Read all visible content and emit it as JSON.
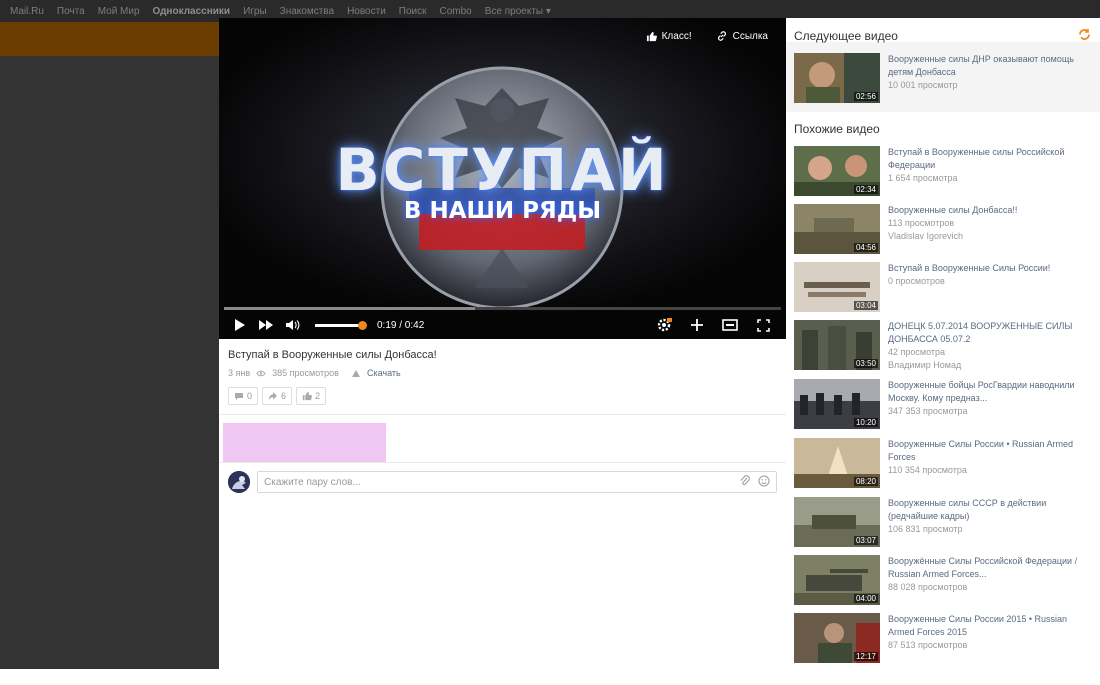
{
  "topbar": {
    "links": [
      "Mail.Ru",
      "Почта",
      "Мой Мир",
      "Одноклассники",
      "Игры",
      "Знакомства",
      "Новости",
      "Поиск",
      "Combo",
      "Все проекты ▾"
    ]
  },
  "player": {
    "headline": "ВСТУПАЙ",
    "subheadline": "В НАШИ РЯДЫ",
    "class_label": "Класс!",
    "link_label": "Ссылка",
    "time": "0:19 / 0:42",
    "progress_fraction": 0.45,
    "volume_fraction": 1.0
  },
  "video": {
    "title": "Вступай в Вооруженные силы Донбасса!",
    "date": "3 янв",
    "views": "385 просмотров",
    "download": "Скачать",
    "comments_count": "0",
    "shares_count": "6",
    "likes_count": "2"
  },
  "comment": {
    "placeholder": "Скажите пару слов..."
  },
  "sidebar": {
    "next_title": "Следующее видео",
    "similar_title": "Похожие видео",
    "next_video": {
      "title": "Вооруженные силы ДНР оказывают помощь детям Донбасса",
      "views": "10 001 просмотр",
      "duration": "02:56"
    },
    "similar": [
      {
        "title": "Вступай в Вооруженные силы Российской Федерации",
        "views": "1 654 просмотра",
        "author": "",
        "duration": "02:34"
      },
      {
        "title": "Вооруженные силы Донбасса!!",
        "views": "113 просмотров",
        "author": "Vladislav Igorevich",
        "duration": "04:56"
      },
      {
        "title": "Вступай в Вооруженные Силы России!",
        "views": "0 просмотров",
        "author": "",
        "duration": "03:04"
      },
      {
        "title": "ДОНЕЦК 5.07.2014 ВООРУЖЕННЫЕ СИЛЫ ДОНБАССА 05.07.2",
        "views": "42 просмотра",
        "author": "Владимир Номад",
        "duration": "03:50"
      },
      {
        "title": "Вооруженные бойцы РосГвардии наводнили Москву. Кому предназ...",
        "views": "347 353 просмотра",
        "author": "",
        "duration": "10:20"
      },
      {
        "title": "Вооруженные Силы России • Russian Armed Forces",
        "views": "110 354 просмотра",
        "author": "",
        "duration": "08:20"
      },
      {
        "title": "Вооруженные силы СССР в действии (редчайшие кадры)",
        "views": "106 831 просмотр",
        "author": "",
        "duration": "03:07"
      },
      {
        "title": "Вооружённые Силы Российской Федерации / Russian Armed Forces...",
        "views": "88 028 просмотров",
        "author": "",
        "duration": "04:00"
      },
      {
        "title": "Вооруженные Силы России 2015 • Russian Armed Forces 2015",
        "views": "87 513 просмотров",
        "author": "",
        "duration": "12:17"
      }
    ]
  },
  "colors": {
    "accent": "#f08a1f",
    "link": "#5b6b80",
    "backdrop": "#333333",
    "ad": "#f0c6f2"
  }
}
